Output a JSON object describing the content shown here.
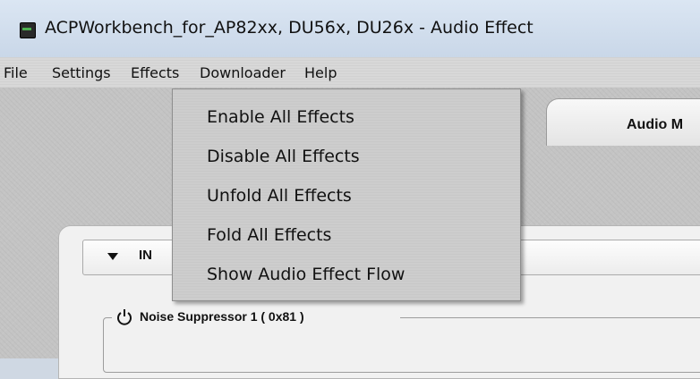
{
  "window": {
    "title": "ACPWorkbench_for_AP82xx, DU56x, DU26x - Audio Effect",
    "icon": "app-icon"
  },
  "menubar": {
    "items": [
      "File",
      "Settings",
      "Effects",
      "Downloader",
      "Help"
    ]
  },
  "effects_menu": {
    "items": [
      "Enable All Effects",
      "Disable All Effects",
      "Unfold All Effects",
      "Fold All Effects",
      "Show Audio Effect Flow"
    ]
  },
  "tabs": {
    "active_label": "Audio M"
  },
  "section": {
    "label": "IN"
  },
  "group": {
    "title": "Noise Suppressor 1 ( 0x81 )",
    "icon": "power-icon"
  }
}
